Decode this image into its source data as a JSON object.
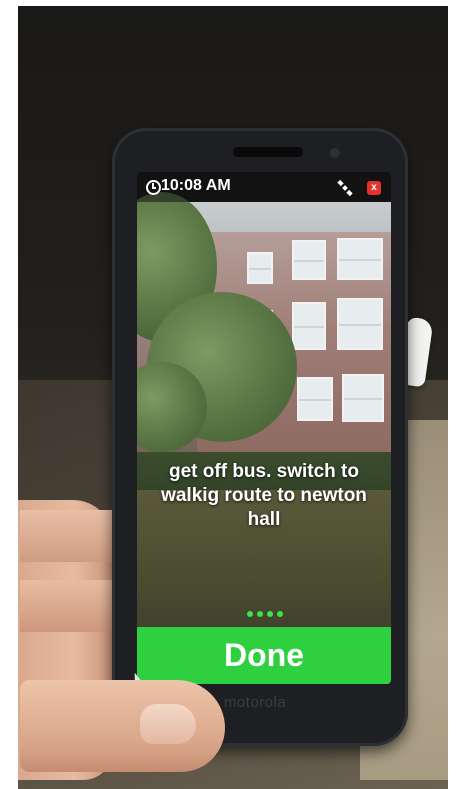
{
  "status_bar": {
    "time": "10:08 AM",
    "clock_icon": "clock-icon",
    "satellite_icon": "satellite-icon",
    "close_label": "x"
  },
  "instruction": {
    "text": "get off bus. switch to walkig route to newton hall"
  },
  "progress": {
    "dot_count": 4,
    "accent": "#39e34a"
  },
  "done_button": {
    "label": "Done",
    "color": "#2ed040"
  },
  "phone": {
    "brand": "motorola"
  },
  "colors": {
    "close_red": "#e5322d"
  }
}
